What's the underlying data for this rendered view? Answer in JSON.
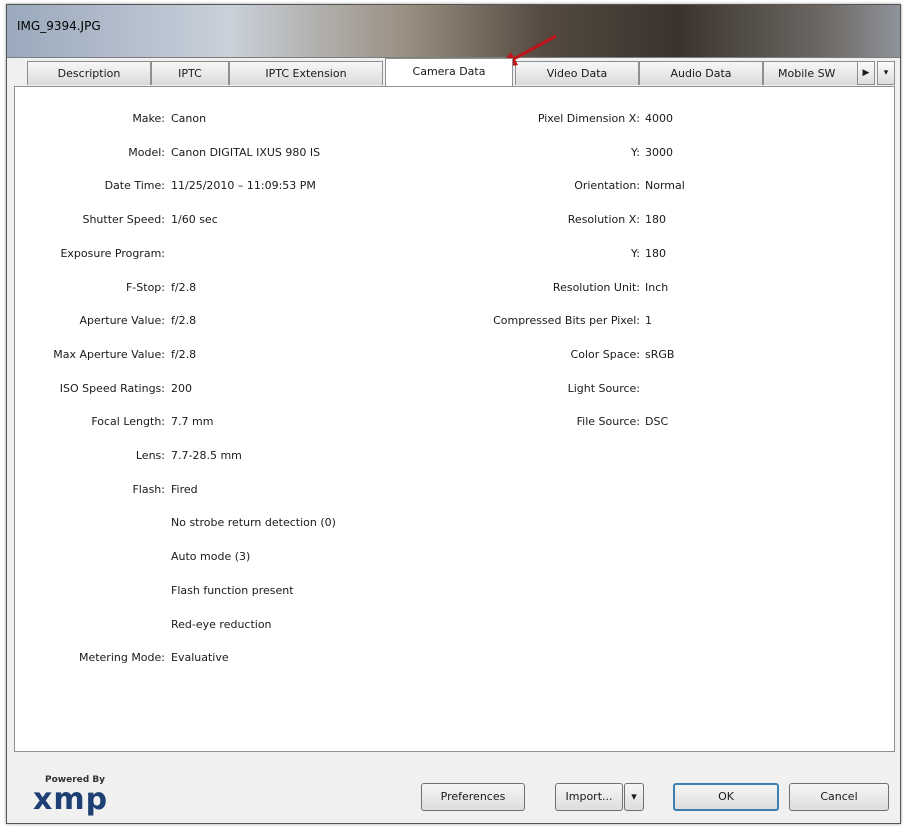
{
  "window": {
    "title": "IMG_9394.JPG"
  },
  "tabs": [
    {
      "label": "Description"
    },
    {
      "label": "IPTC"
    },
    {
      "label": "IPTC Extension"
    },
    {
      "label": "Camera Data"
    },
    {
      "label": "Video Data"
    },
    {
      "label": "Audio Data"
    },
    {
      "label": "Mobile SW"
    }
  ],
  "tab_scroll": {
    "right": "▶",
    "menu": "▾"
  },
  "left_fields": [
    {
      "label": "Make:",
      "value": "Canon"
    },
    {
      "label": "Model:",
      "value": "Canon DIGITAL IXUS 980 IS"
    },
    {
      "label": "Date Time:",
      "value": "11/25/2010 – 11:09:53 PM"
    },
    {
      "label": "Shutter Speed:",
      "value": "1/60 sec"
    },
    {
      "label": "Exposure Program:",
      "value": ""
    },
    {
      "label": "F-Stop:",
      "value": "f/2.8"
    },
    {
      "label": "Aperture Value:",
      "value": "f/2.8"
    },
    {
      "label": "Max Aperture Value:",
      "value": "f/2.8"
    },
    {
      "label": "ISO Speed Ratings:",
      "value": "200"
    },
    {
      "label": "Focal Length:",
      "value": "7.7 mm"
    },
    {
      "label": "Lens:",
      "value": "7.7-28.5 mm"
    },
    {
      "label": "Flash:",
      "value": "Fired"
    },
    {
      "label": "",
      "value": "No strobe return detection (0)"
    },
    {
      "label": "",
      "value": "Auto mode (3)"
    },
    {
      "label": "",
      "value": "Flash function present"
    },
    {
      "label": "",
      "value": "Red-eye reduction"
    },
    {
      "label": "Metering Mode:",
      "value": "Evaluative"
    }
  ],
  "right_fields": [
    {
      "label": "Pixel Dimension X:",
      "value": "4000"
    },
    {
      "label": "Y:",
      "value": "3000"
    },
    {
      "label": "Orientation:",
      "value": "Normal"
    },
    {
      "label": "Resolution X:",
      "value": "180"
    },
    {
      "label": "Y:",
      "value": "180"
    },
    {
      "label": "Resolution Unit:",
      "value": "Inch"
    },
    {
      "label": "Compressed Bits per Pixel:",
      "value": "1"
    },
    {
      "label": "Color Space:",
      "value": "sRGB"
    },
    {
      "label": "Light Source:",
      "value": ""
    },
    {
      "label": "File Source:",
      "value": "DSC"
    }
  ],
  "footer": {
    "powered_by": "Powered By",
    "logo": "xmp",
    "preferences": "Preferences",
    "import": "Import...",
    "import_dropdown": "▾",
    "ok": "OK",
    "cancel": "Cancel"
  },
  "colors": {
    "arrow": "#c0141b",
    "logo": "#1d3f73",
    "default_button_border": "#3c7fb1"
  }
}
